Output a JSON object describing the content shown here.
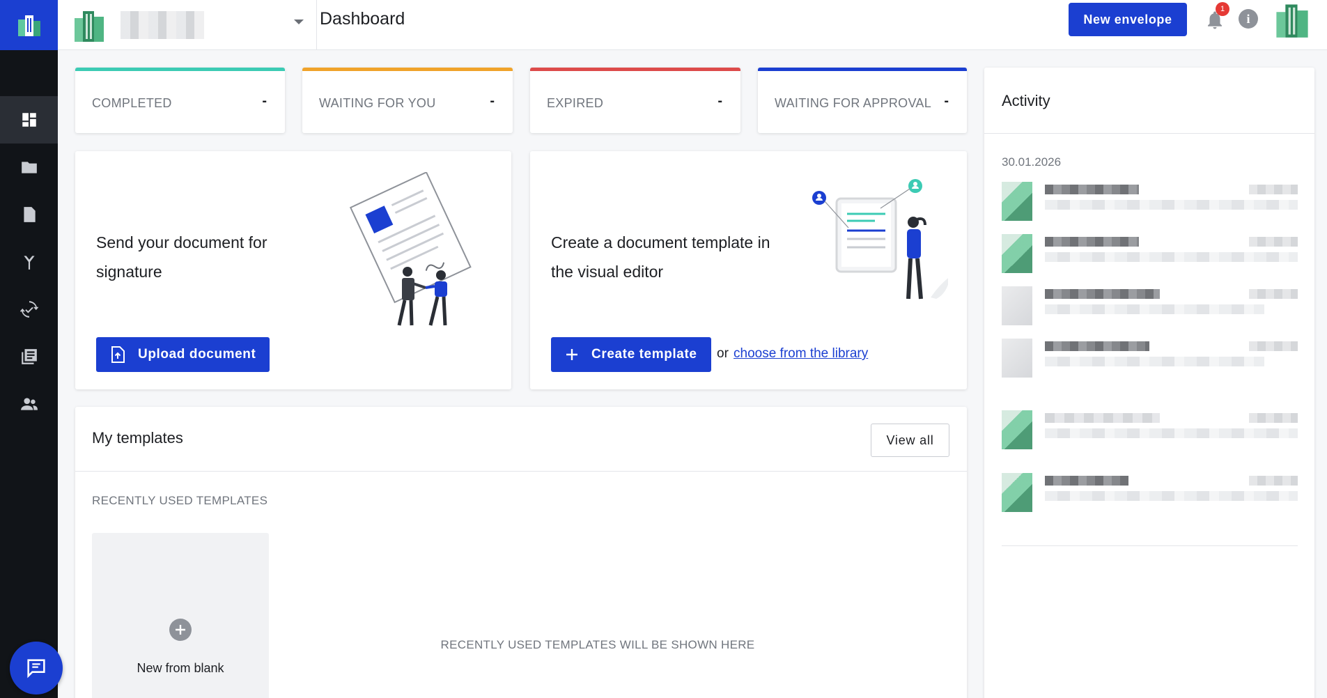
{
  "header": {
    "page_title": "Dashboard",
    "new_envelope_label": "New envelope",
    "notification_count": "1",
    "info_label": "i"
  },
  "stats": [
    {
      "label": "COMPLETED",
      "value": "-",
      "color": "#3ccbb4"
    },
    {
      "label": "WAITING FOR YOU",
      "value": "-",
      "color": "#f0a32b"
    },
    {
      "label": "EXPIRED",
      "value": "-",
      "color": "#dd4b4b"
    },
    {
      "label": "WAITING FOR APPROVAL",
      "value": "-",
      "color": "#1b3fd1"
    }
  ],
  "send_card": {
    "title": "Send your document for signature",
    "button_label": "Upload document"
  },
  "template_card": {
    "title": "Create a document template in the visual editor",
    "button_label": "Create template",
    "or_text": "or",
    "library_link": "choose from the library"
  },
  "templates": {
    "title": "My templates",
    "view_all_label": "View all",
    "recent_label": "RECENTLY USED TEMPLATES",
    "blank_label": "New from blank",
    "empty_message": "RECENTLY USED TEMPLATES WILL BE SHOWN HERE"
  },
  "activity": {
    "title": "Activity",
    "date": "30.01.2026"
  },
  "colors": {
    "primary": "#1b3fd1",
    "sidebar": "#111418",
    "teal": "#3ccbb4"
  }
}
